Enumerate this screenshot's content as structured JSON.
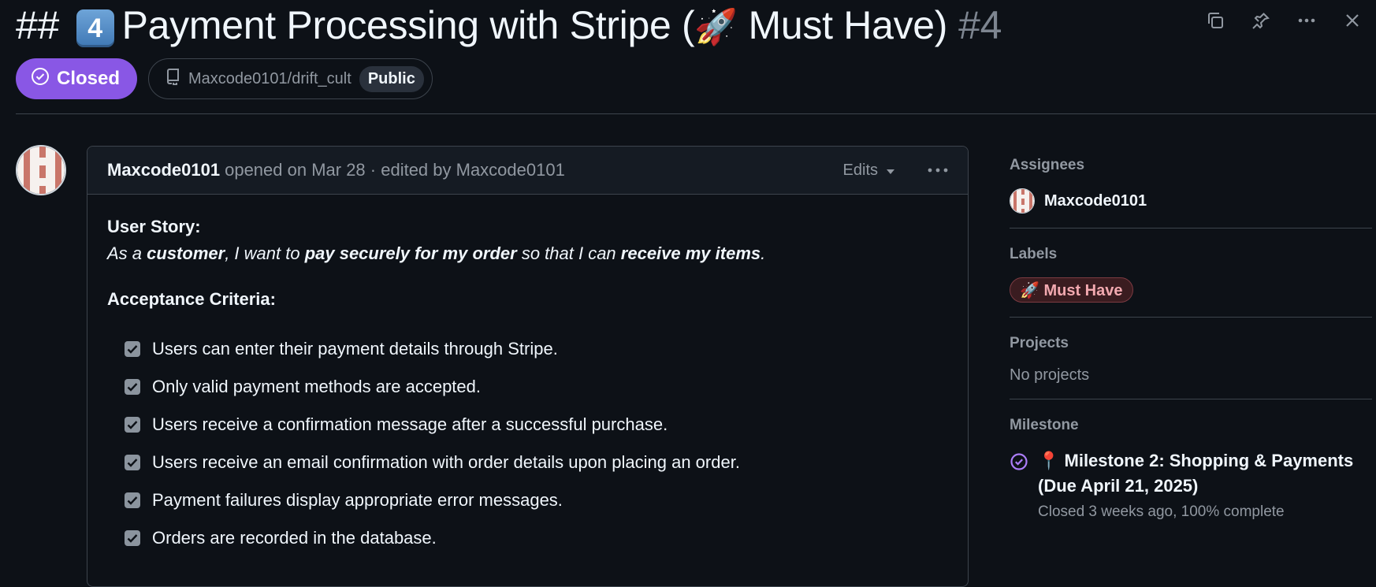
{
  "issue": {
    "title_prefix": "##",
    "keycap": "4",
    "title_main": "Payment Processing with Stripe (",
    "title_emoji": "🚀",
    "title_suffix": " Must Have)",
    "number": "#4",
    "state": "Closed",
    "repo": "Maxcode0101/drift_cult",
    "visibility": "Public"
  },
  "comment": {
    "author": "Maxcode0101",
    "meta": "opened on Mar 28 · edited by Maxcode0101",
    "edits_label": "Edits",
    "story_heading": "User Story:",
    "story": {
      "p1": "As a ",
      "b1": "customer",
      "p2": ", I want to ",
      "b2": "pay securely for my order",
      "p3": " so that I can ",
      "b3": "receive my items",
      "p4": "."
    },
    "criteria_heading": "Acceptance Criteria:",
    "criteria": [
      "Users can enter their payment details through Stripe.",
      "Only valid payment methods are accepted.",
      "Users receive a confirmation message after a successful purchase.",
      "Users receive an email confirmation with order details upon placing an order.",
      "Payment failures display appropriate error messages.",
      "Orders are recorded in the database."
    ]
  },
  "sidebar": {
    "assignees": {
      "title": "Assignees",
      "user": "Maxcode0101"
    },
    "labels": {
      "title": "Labels",
      "label": "🚀 Must Have"
    },
    "projects": {
      "title": "Projects",
      "value": "No projects"
    },
    "milestone": {
      "title": "Milestone",
      "name": "📍 Milestone 2: Shopping & Payments (Due April 21, 2025)",
      "status": "Closed 3 weeks ago, 100% complete"
    }
  },
  "colors": {
    "background": "#0d1117",
    "closed_badge": "#8957e5",
    "label_text": "#f2a9b0",
    "milestone_icon": "#ab7df8"
  },
  "icons": [
    "copy-icon",
    "pin-icon",
    "kebab-horizontal-icon",
    "close-icon",
    "check-circle-icon",
    "repo-icon",
    "triangle-down-icon",
    "checkbox-checked-icon",
    "milestone-check-icon"
  ]
}
